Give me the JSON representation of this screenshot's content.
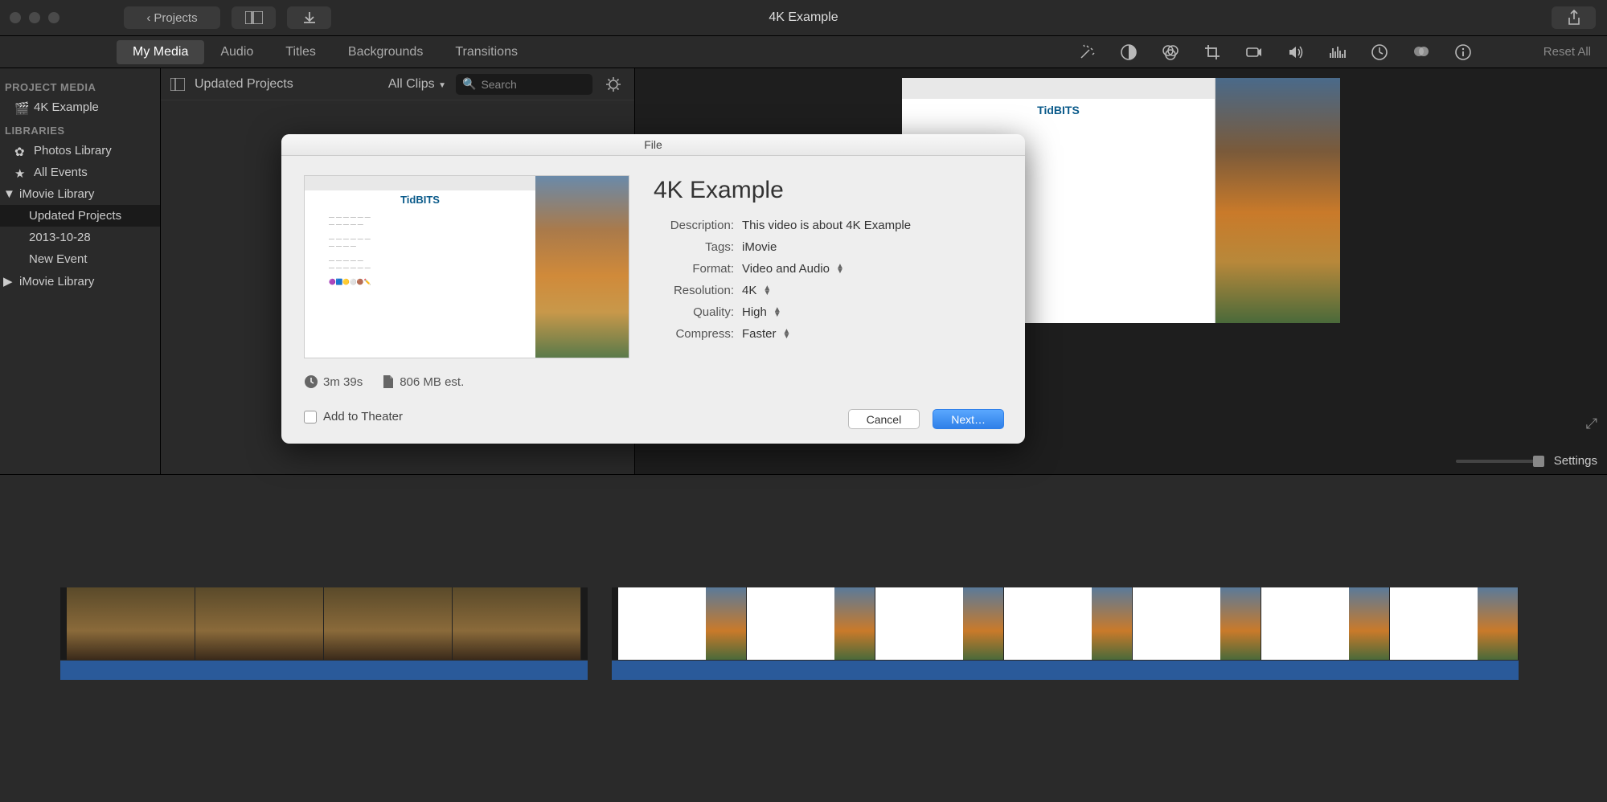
{
  "titlebar": {
    "projects_label": "Projects",
    "title": "4K Example"
  },
  "tabs": {
    "my_media": "My Media",
    "audio": "Audio",
    "titles": "Titles",
    "backgrounds": "Backgrounds",
    "transitions": "Transitions"
  },
  "right_toolbar": {
    "reset": "Reset All"
  },
  "sidebar": {
    "head_project": "PROJECT MEDIA",
    "project_item": "4K Example",
    "head_libraries": "LIBRARIES",
    "photos": "Photos Library",
    "all_events": "All Events",
    "imovie_lib": "iMovie Library",
    "updated": "Updated Projects",
    "date": "2013-10-28",
    "new_event": "New Event",
    "imovie_lib2": "iMovie Library"
  },
  "browser": {
    "title": "Updated Projects",
    "filter": "All Clips",
    "search_placeholder": "Search"
  },
  "viewer": {
    "logo": "TidBITS",
    "settings": "Settings"
  },
  "modal": {
    "title": "File",
    "heading": "4K Example",
    "desc_label": "Description:",
    "desc_value": "This video is about 4K Example",
    "tags_label": "Tags:",
    "tags_value": "iMovie",
    "format_label": "Format:",
    "format_value": "Video and Audio",
    "resolution_label": "Resolution:",
    "resolution_value": "4K",
    "quality_label": "Quality:",
    "quality_value": "High",
    "compress_label": "Compress:",
    "compress_value": "Faster",
    "duration": "3m 39s",
    "filesize": "806 MB est.",
    "add_theater": "Add to Theater",
    "cancel": "Cancel",
    "next": "Next…",
    "preview_logo": "TidBITS"
  }
}
